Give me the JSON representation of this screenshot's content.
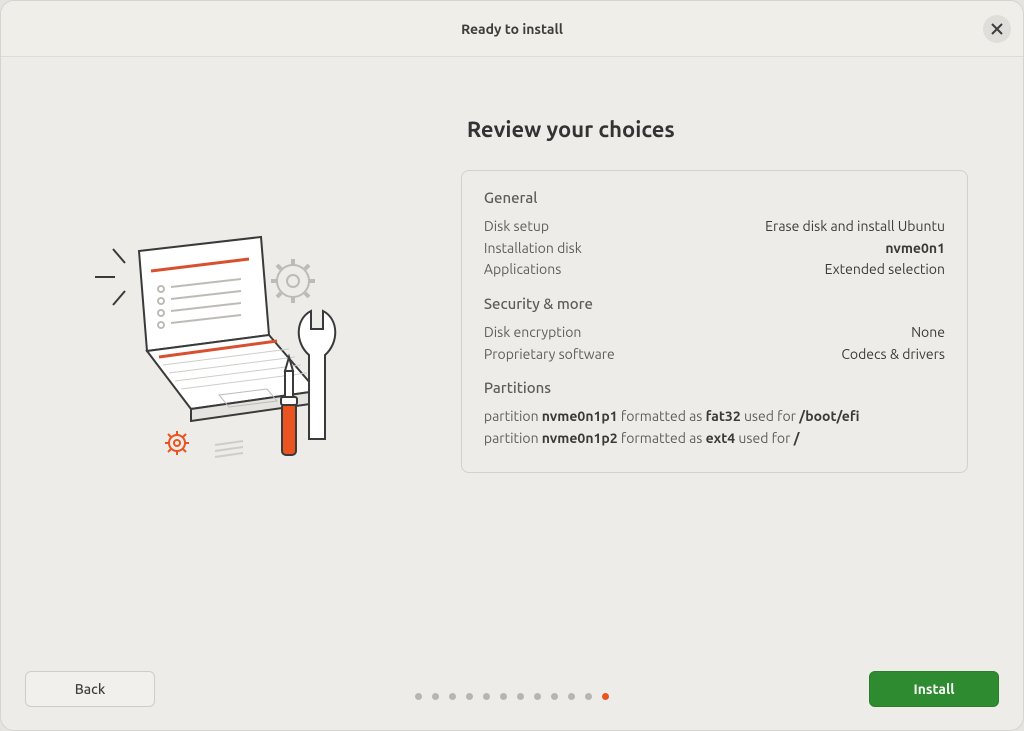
{
  "titlebar": {
    "title": "Ready to install"
  },
  "main": {
    "heading": "Review your choices",
    "sections": {
      "general": {
        "title": "General",
        "rows": [
          {
            "k": "Disk setup",
            "v": "Erase disk and install Ubuntu",
            "bold": false
          },
          {
            "k": "Installation disk",
            "v": "nvme0n1",
            "bold": true
          },
          {
            "k": "Applications",
            "v": "Extended selection",
            "bold": false
          }
        ]
      },
      "security": {
        "title": "Security & more",
        "rows": [
          {
            "k": "Disk encryption",
            "v": "None",
            "bold": false
          },
          {
            "k": "Proprietary software",
            "v": "Codecs & drivers",
            "bold": false
          }
        ]
      },
      "partitions": {
        "title": "Partitions",
        "lines": [
          {
            "prefix": "partition",
            "name": "nvme0n1p1",
            "mid1": "formatted as",
            "fs": "fat32",
            "mid2": "used for",
            "mount": "/boot/efi"
          },
          {
            "prefix": "partition",
            "name": "nvme0n1p2",
            "mid1": "formatted as",
            "fs": "ext4",
            "mid2": "used for",
            "mount": "/"
          }
        ]
      }
    }
  },
  "footer": {
    "back": "Back",
    "install": "Install",
    "steps_total": 12,
    "steps_current": 12
  },
  "colors": {
    "accent": "#e95420",
    "primary_btn": "#2f8b2f"
  }
}
